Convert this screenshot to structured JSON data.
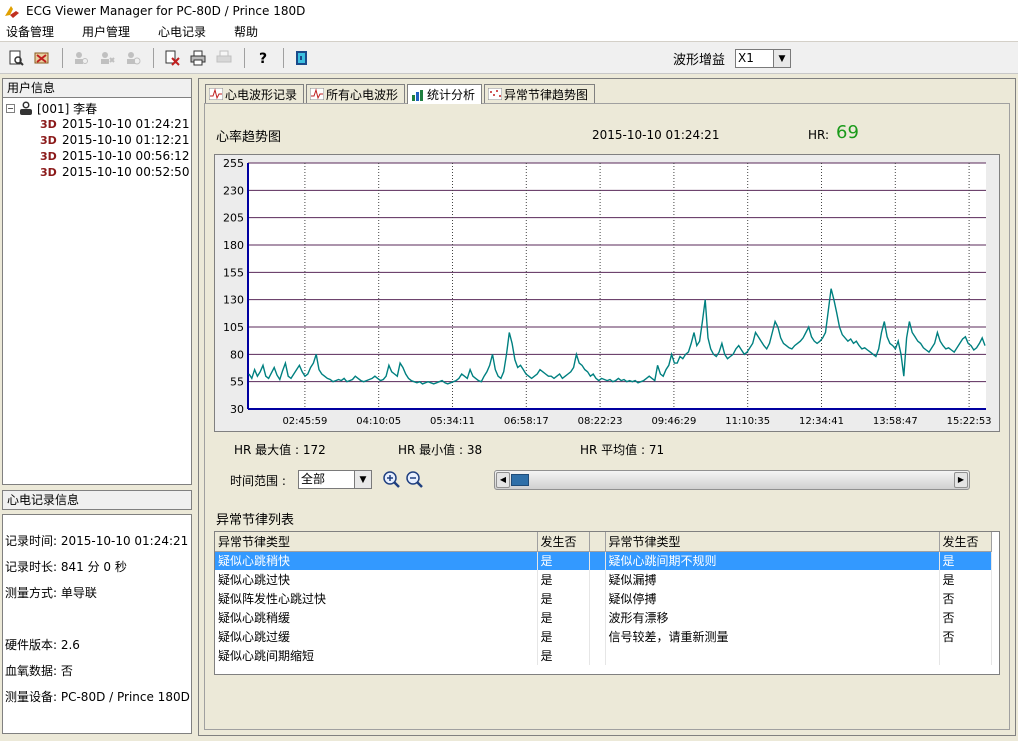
{
  "window": {
    "title": "ECG Viewer Manager for PC-80D / Prince 180D"
  },
  "menu": [
    "设备管理",
    "用户管理",
    "心电记录",
    "帮助"
  ],
  "toolbar": {
    "buttons": [
      {
        "icon": "print-preview-icon",
        "enabled": true
      },
      {
        "icon": "delete-user-icon",
        "enabled": true
      },
      {
        "icon": "user-search-icon",
        "enabled": false
      },
      {
        "icon": "user-add-icon",
        "enabled": false
      },
      {
        "icon": "user-edit-icon",
        "enabled": false
      },
      {
        "icon": "delete-record-icon",
        "enabled": true
      },
      {
        "icon": "printer-icon",
        "enabled": true
      },
      {
        "icon": "print-setup-icon",
        "enabled": false
      },
      {
        "icon": "help-icon",
        "enabled": true
      },
      {
        "icon": "exit-icon",
        "enabled": true
      }
    ],
    "gain_label": "波形增益",
    "gain_value": "X1"
  },
  "user_panel": {
    "header": "用户信息",
    "root_label": "[001] 李春",
    "records": [
      {
        "badge": "3D",
        "datetime": "2015-10-10   01:24:21"
      },
      {
        "badge": "3D",
        "datetime": "2015-10-10   01:12:21"
      },
      {
        "badge": "3D",
        "datetime": "2015-10-10   00:56:12"
      },
      {
        "badge": "3D",
        "datetime": "2015-10-10   00:52:50"
      }
    ]
  },
  "record_panel": {
    "header": "心电记录信息",
    "record_time": "记录时间: 2015-10-10   01:24:21",
    "duration": "记录时长: 841 分 0 秒",
    "mode": "测量方式: 单导联",
    "hw_version": "硬件版本: 2.6",
    "spo2": "血氧数据: 否",
    "device": "测量设备: PC-80D / Prince 180D"
  },
  "tabs": [
    {
      "label": "心电波形记录",
      "active": false
    },
    {
      "label": "所有心电波形",
      "active": false
    },
    {
      "label": "统计分析",
      "active": true
    },
    {
      "label": "异常节律趋势图",
      "active": false
    }
  ],
  "chart_header": {
    "title": "心率趋势图",
    "datetime": "2015-10-10   01:24:21",
    "hr_label": "HR:",
    "hr_value": "69"
  },
  "chart_data": {
    "type": "line",
    "title": "心率趋势图",
    "xlabel": "",
    "ylabel": "",
    "ylim": [
      30,
      255
    ],
    "yticks": [
      30,
      55,
      80,
      105,
      130,
      155,
      180,
      205,
      230,
      255
    ],
    "xticks": [
      "02:45:59",
      "04:10:05",
      "05:34:11",
      "06:58:17",
      "08:22:23",
      "09:46:29",
      "11:10:35",
      "12:34:41",
      "13:58:47",
      "15:22:53"
    ],
    "x_range_minutes": 841,
    "series": [
      {
        "color": "#008080",
        "values": [
          62,
          58,
          66,
          60,
          64,
          70,
          60,
          58,
          63,
          68,
          61,
          57,
          65,
          72,
          60,
          58,
          62,
          66,
          70,
          64,
          60,
          62,
          68,
          72,
          80,
          66,
          62,
          60,
          58,
          57,
          55,
          56,
          57,
          56,
          58,
          55,
          56,
          57,
          60,
          58,
          56,
          55,
          56,
          57,
          58,
          60,
          58,
          56,
          57,
          60,
          70,
          64,
          62,
          60,
          72,
          68,
          62,
          58,
          56,
          55,
          54,
          55,
          53,
          54,
          55,
          54,
          53,
          54,
          55,
          56,
          54,
          53,
          54,
          55,
          56,
          58,
          62,
          60,
          58,
          66,
          60,
          58,
          56,
          55,
          60,
          64,
          70,
          80,
          66,
          60,
          58,
          64,
          80,
          100,
          90,
          75,
          68,
          70,
          66,
          62,
          60,
          58,
          60,
          62,
          66,
          64,
          62,
          60,
          60,
          58,
          60,
          62,
          58,
          60,
          62,
          64,
          68,
          80,
          72,
          70,
          66,
          64,
          60,
          62,
          58,
          56,
          58,
          57,
          56,
          57,
          55,
          56,
          58,
          56,
          57,
          55,
          56,
          55,
          56,
          54,
          55,
          56,
          58,
          60,
          58,
          56,
          70,
          62,
          60,
          66,
          70,
          80,
          72,
          72,
          78,
          76,
          80,
          82,
          90,
          100,
          88,
          92,
          110,
          130,
          95,
          85,
          80,
          78,
          82,
          90,
          80,
          76,
          78,
          80,
          85,
          88,
          84,
          80,
          82,
          86,
          90,
          100,
          96,
          92,
          88,
          85,
          90,
          100,
          110,
          105,
          95,
          90,
          88,
          86,
          85,
          88,
          90,
          92,
          95,
          100,
          105,
          96,
          92,
          90,
          92,
          95,
          100,
          120,
          140,
          130,
          118,
          105,
          98,
          95,
          92,
          94,
          90,
          92,
          88,
          85,
          86,
          84,
          82,
          80,
          78,
          85,
          100,
          110,
          96,
          90,
          88,
          85,
          92,
          80,
          60,
          95,
          110,
          100,
          96,
          92,
          90,
          86,
          84,
          82,
          86,
          90,
          100,
          92,
          88,
          85,
          86,
          84,
          82,
          86,
          90,
          94,
          96,
          90,
          88,
          84,
          86,
          90,
          95,
          88
        ]
      }
    ],
    "grid": true,
    "legend": "none"
  },
  "stats": {
    "max": "HR 最大值 : 172",
    "min": "HR 最小值 : 38",
    "avg": "HR 平均值 : 71"
  },
  "range": {
    "label": "时间范围 :",
    "value": "全部"
  },
  "abnormal_table": {
    "title": "异常节律列表",
    "headers": [
      "异常节律类型",
      "发生否",
      "",
      "异常节律类型",
      "发生否"
    ],
    "rows": [
      [
        "疑似心跳稍快",
        "是",
        "",
        "疑似心跳间期不规则",
        "是"
      ],
      [
        "疑似心跳过快",
        "是",
        "",
        "疑似漏搏",
        "是"
      ],
      [
        "疑似阵发性心跳过快",
        "是",
        "",
        "疑似停搏",
        "否"
      ],
      [
        "疑似心跳稍缓",
        "是",
        "",
        "波形有漂移",
        "否"
      ],
      [
        "疑似心跳过缓",
        "是",
        "",
        "信号较差，请重新测量",
        "否"
      ],
      [
        "疑似心跳间期缩短",
        "是",
        "",
        "",
        ""
      ]
    ]
  }
}
